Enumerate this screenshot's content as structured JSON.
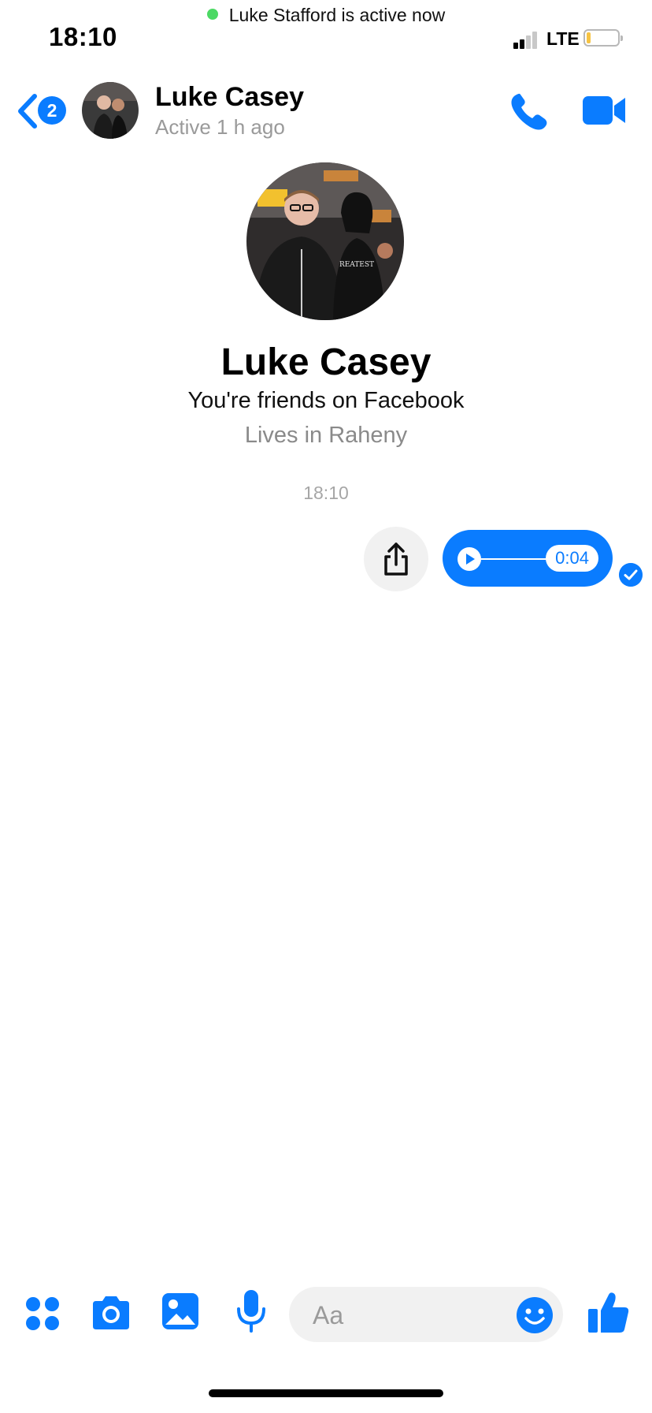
{
  "status_bar": {
    "time": "18:10",
    "banner": "Luke Stafford is active now",
    "network": "LTE"
  },
  "header": {
    "back_badge": "2",
    "contact_name": "Luke Casey",
    "contact_status": "Active 1 h ago",
    "call_icon": "phone-icon",
    "video_icon": "video-camera-icon"
  },
  "profile": {
    "name": "Luke Casey",
    "friendship": "You're friends on Facebook",
    "location": "Lives in Raheny"
  },
  "conversation": {
    "timestamp": "18:10",
    "voice_message": {
      "duration": "0:04",
      "read": true
    }
  },
  "composer": {
    "placeholder": "Aa",
    "icons": [
      "apps-icon",
      "camera-icon",
      "gallery-icon",
      "microphone-icon",
      "emoji-icon",
      "like-icon"
    ]
  },
  "colors": {
    "accent": "#0a7cff",
    "online": "#4cd964",
    "muted_text": "#9a9a9a",
    "surface": "#f1f1f1"
  }
}
